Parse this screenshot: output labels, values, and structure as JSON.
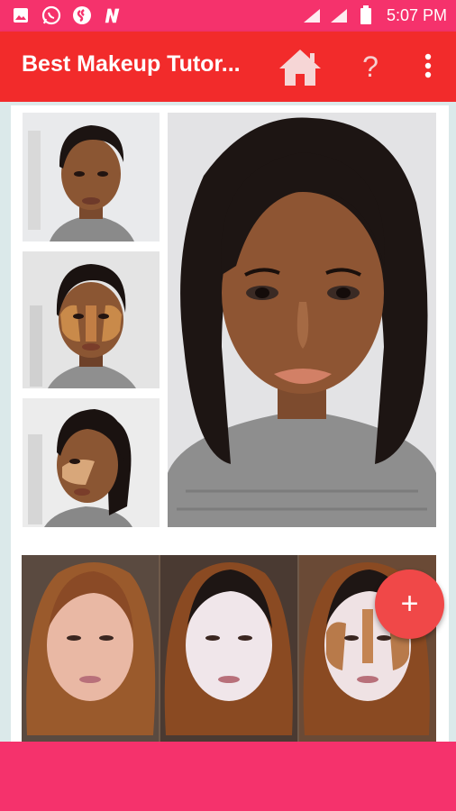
{
  "status_bar": {
    "time": "5:07 PM",
    "icons": [
      "image-icon",
      "whatsapp-icon",
      "shazam-icon",
      "netflix-icon",
      "signal-icon",
      "signal-icon",
      "battery-icon"
    ]
  },
  "app_bar": {
    "title": "Best Makeup Tutor...",
    "help_label": "?",
    "icons": [
      "home-icon",
      "help-icon",
      "more-vert-icon"
    ]
  },
  "fab": {
    "label": "+"
  },
  "colors": {
    "status_bar": "#f5326c",
    "app_bar": "#f22b2b",
    "fab": "#f04848",
    "background": "#dbe9ea"
  }
}
